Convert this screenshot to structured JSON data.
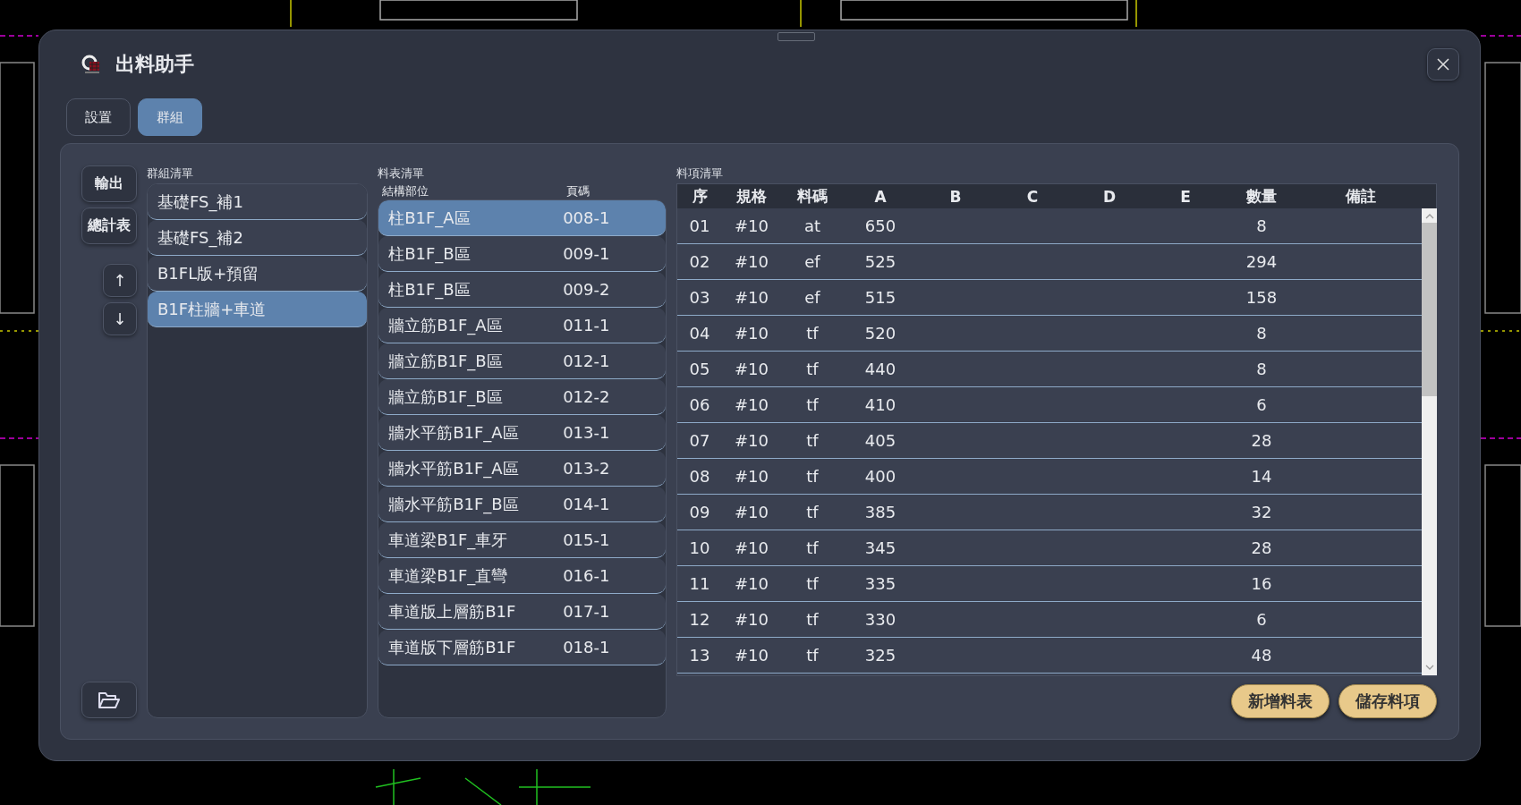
{
  "window": {
    "title": "出料助手"
  },
  "tabs": [
    {
      "label": "設置",
      "selected": false
    },
    {
      "label": "群組",
      "selected": true
    }
  ],
  "side_buttons": [
    {
      "kind": "text",
      "label": "輸出"
    },
    {
      "kind": "text",
      "label": "總計表"
    },
    {
      "kind": "arrow",
      "label": "↑"
    },
    {
      "kind": "arrow",
      "label": "↓"
    }
  ],
  "group_list": {
    "label": "群組清單",
    "items": [
      {
        "label": "基礎FS_補1",
        "selected": false
      },
      {
        "label": "基礎FS_補2",
        "selected": false
      },
      {
        "label": "B1FL版+預留",
        "selected": false
      },
      {
        "label": "B1F柱牆+車道",
        "selected": true
      }
    ]
  },
  "sheet_list": {
    "label": "料表清單",
    "columns": [
      "結構部位",
      "頁碼"
    ],
    "rows": [
      {
        "part": "柱B1F_A區",
        "page": "008-1",
        "selected": true
      },
      {
        "part": "柱B1F_B區",
        "page": "009-1",
        "selected": false
      },
      {
        "part": "柱B1F_B區",
        "page": "009-2",
        "selected": false
      },
      {
        "part": "牆立筋B1F_A區",
        "page": "011-1",
        "selected": false
      },
      {
        "part": "牆立筋B1F_B區",
        "page": "012-1",
        "selected": false
      },
      {
        "part": "牆立筋B1F_B區",
        "page": "012-2",
        "selected": false
      },
      {
        "part": "牆水平筋B1F_A區",
        "page": "013-1",
        "selected": false
      },
      {
        "part": "牆水平筋B1F_A區",
        "page": "013-2",
        "selected": false
      },
      {
        "part": "牆水平筋B1F_B區",
        "page": "014-1",
        "selected": false
      },
      {
        "part": "車道梁B1F_車牙",
        "page": "015-1",
        "selected": false
      },
      {
        "part": "車道梁B1F_直彎",
        "page": "016-1",
        "selected": false
      },
      {
        "part": "車道版上層筋B1F",
        "page": "017-1",
        "selected": false
      },
      {
        "part": "車道版下層筋B1F",
        "page": "018-1",
        "selected": false
      }
    ]
  },
  "item_list": {
    "label": "料項清單",
    "columns": [
      "序",
      "規格",
      "料碼",
      "A",
      "B",
      "C",
      "D",
      "E",
      "數量",
      "備註"
    ],
    "rows": [
      [
        "01",
        "#10",
        "at",
        "650",
        null,
        null,
        null,
        null,
        "8",
        null
      ],
      [
        "02",
        "#10",
        "ef",
        "525",
        null,
        null,
        null,
        null,
        "294",
        null
      ],
      [
        "03",
        "#10",
        "ef",
        "515",
        null,
        null,
        null,
        null,
        "158",
        null
      ],
      [
        "04",
        "#10",
        "tf",
        "520",
        null,
        null,
        null,
        null,
        "8",
        null
      ],
      [
        "05",
        "#10",
        "tf",
        "440",
        null,
        null,
        null,
        null,
        "8",
        null
      ],
      [
        "06",
        "#10",
        "tf",
        "410",
        null,
        null,
        null,
        null,
        "6",
        null
      ],
      [
        "07",
        "#10",
        "tf",
        "405",
        null,
        null,
        null,
        null,
        "28",
        null
      ],
      [
        "08",
        "#10",
        "tf",
        "400",
        null,
        null,
        null,
        null,
        "14",
        null
      ],
      [
        "09",
        "#10",
        "tf",
        "385",
        null,
        null,
        null,
        null,
        "32",
        null
      ],
      [
        "10",
        "#10",
        "tf",
        "345",
        null,
        null,
        null,
        null,
        "28",
        null
      ],
      [
        "11",
        "#10",
        "tf",
        "335",
        null,
        null,
        null,
        null,
        "16",
        null
      ],
      [
        "12",
        "#10",
        "tf",
        "330",
        null,
        null,
        null,
        null,
        "6",
        null
      ],
      [
        "13",
        "#10",
        "tf",
        "325",
        null,
        null,
        null,
        null,
        "48",
        null
      ]
    ]
  },
  "buttons": [
    "新增料表",
    "儲存料項"
  ]
}
